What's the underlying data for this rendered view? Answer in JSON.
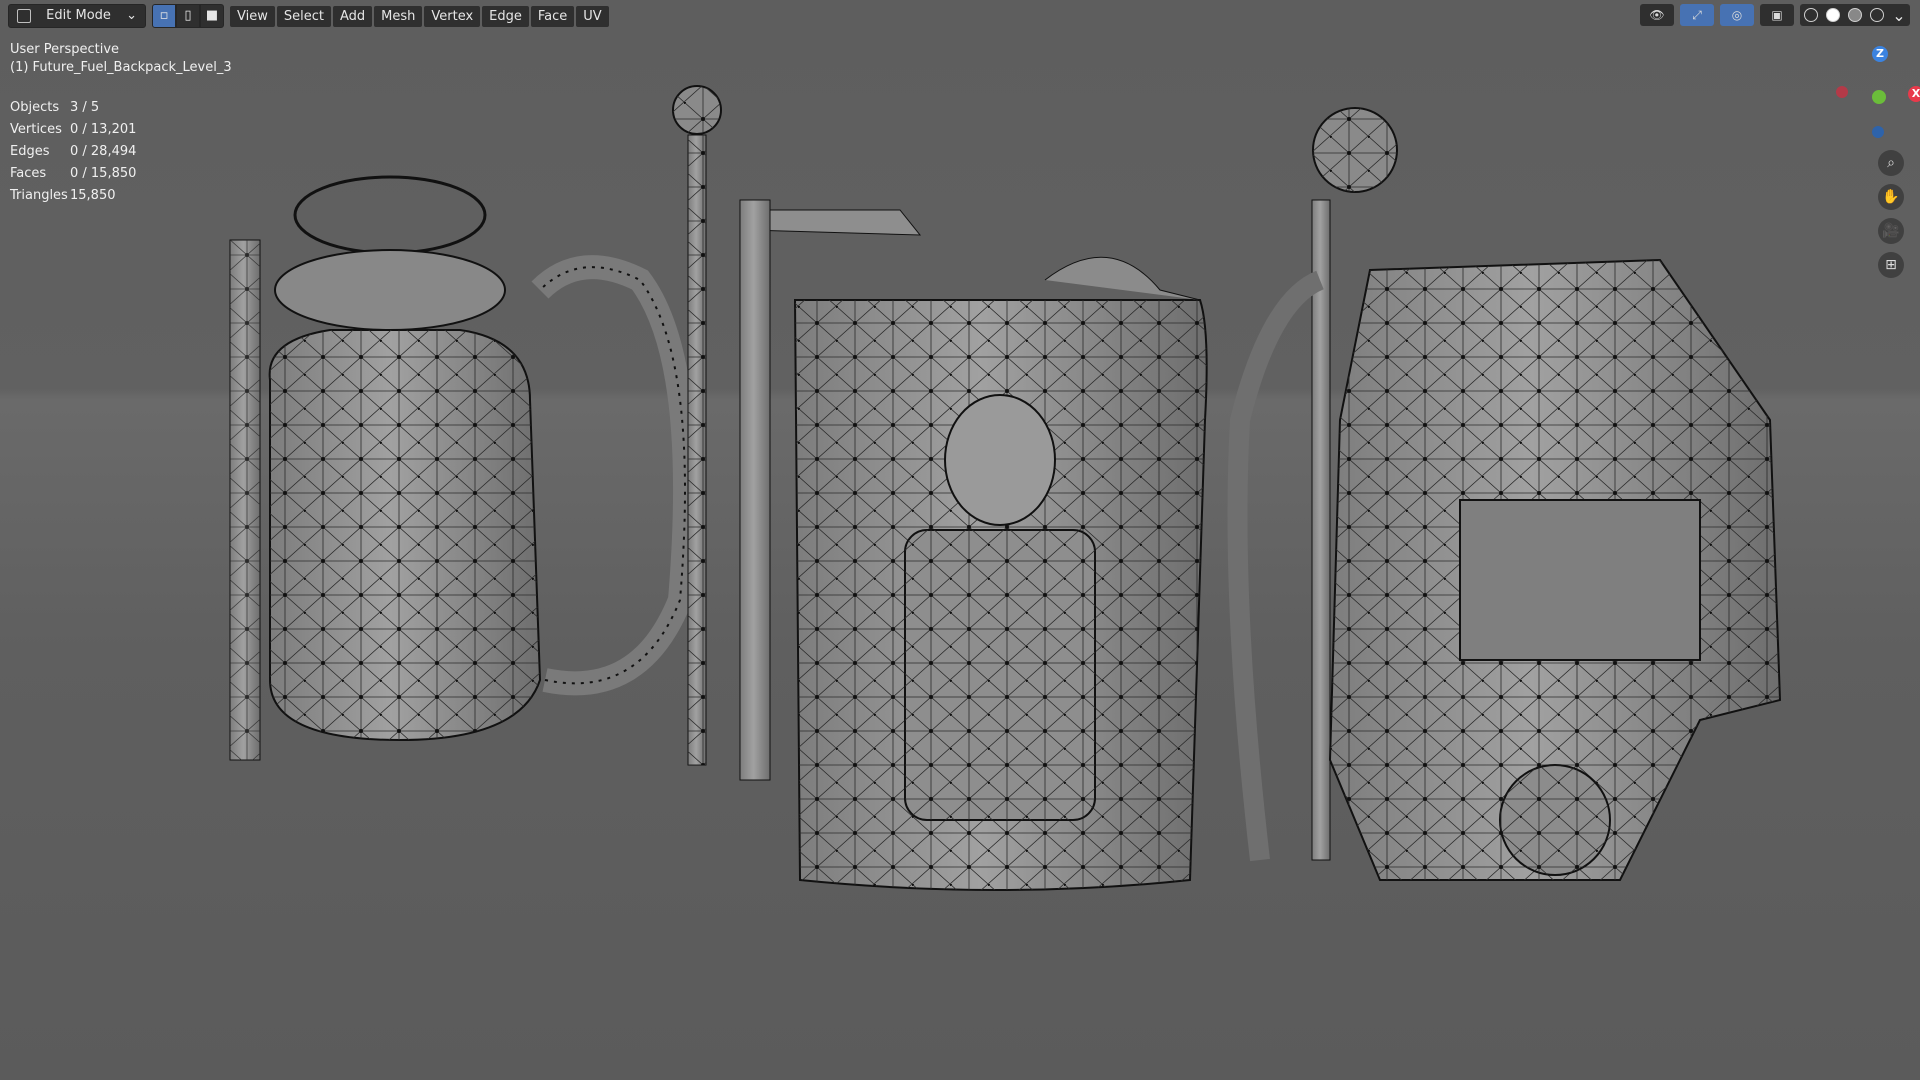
{
  "header": {
    "mode": "Edit Mode",
    "menus": [
      "View",
      "Select",
      "Add",
      "Mesh",
      "Vertex",
      "Edge",
      "Face",
      "UV"
    ]
  },
  "viewport": {
    "perspective": "User Perspective",
    "object": "(1) Future_Fuel_Backpack_Level_3"
  },
  "stats": [
    {
      "label": "Objects",
      "value": "3 / 5"
    },
    {
      "label": "Vertices",
      "value": "0 / 13,201"
    },
    {
      "label": "Edges",
      "value": "0 / 28,494"
    },
    {
      "label": "Faces",
      "value": "0 / 15,850"
    },
    {
      "label": "Triangles",
      "value": "15,850"
    }
  ],
  "gizmo": {
    "z": "Z",
    "x": "X"
  },
  "icons": {
    "zoom": "zoom-icon",
    "pan": "pan-hand-icon",
    "camera": "camera-icon",
    "grid": "grid-icon"
  },
  "colors": {
    "x_axis": "#e83a4b",
    "y_axis": "#6bbd3a",
    "z_axis": "#3b83e0",
    "active_button": "#4772b3"
  }
}
